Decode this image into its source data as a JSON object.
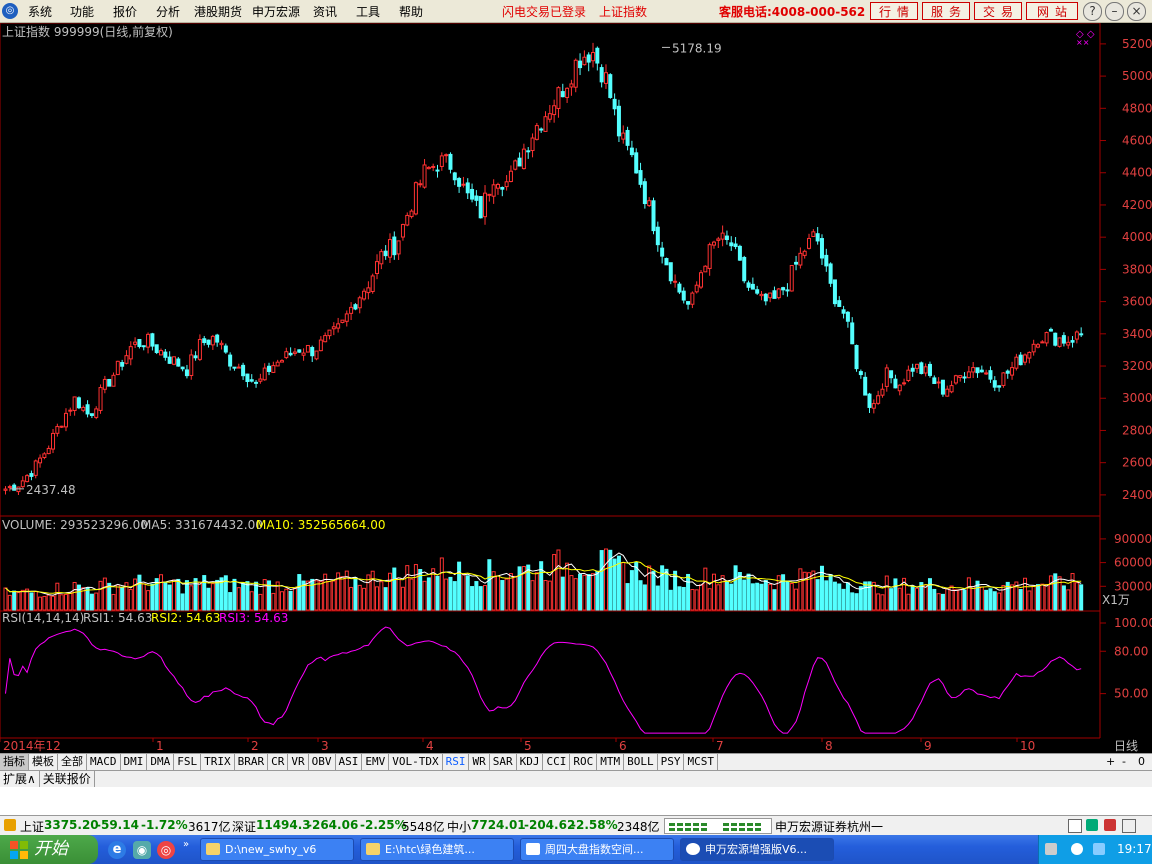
{
  "menu": {
    "items": [
      "系统",
      "功能",
      "报价",
      "分析",
      "港股期货",
      "申万宏源",
      "资讯",
      "工具",
      "帮助"
    ],
    "notice1": "闪电交易已登录",
    "notice2": "上证指数",
    "phone": "客服电话:4008-000-562",
    "buttons": [
      "行情",
      "服务",
      "交易",
      "网站"
    ]
  },
  "chart_header": {
    "title": "上证指数 999999(日线,前复权)",
    "high_label": "5178.19",
    "low_label": "2437.48",
    "volume_label": "VOLUME: 293523296.00",
    "ma5_label": "MA5: 331674432.00",
    "ma10_label": "MA10: 352565664.00",
    "rsi_label": "RSI(14,14,14)",
    "rsi1_label": "RSI1: 54.63",
    "rsi2_label": "RSI2: 54.63",
    "rsi3_label": "RSI3: 54.63",
    "vol_unit": "X1万",
    "period": "日线"
  },
  "chart_data": [
    {
      "type": "candlestick",
      "title": "上证指数 999999(日线,前复权)",
      "ylim": [
        2300,
        5280
      ],
      "yticks": [
        2400,
        2600,
        2800,
        3000,
        3200,
        3400,
        3600,
        3800,
        4000,
        4200,
        4400,
        4600,
        4800,
        5000,
        5200
      ],
      "x_labels": [
        "2014年12",
        "1",
        "2",
        "3",
        "4",
        "5",
        "6",
        "7",
        "8",
        "9",
        "10"
      ],
      "closes": [
        2437,
        2470,
        2560,
        2690,
        2860,
        3000,
        2890,
        3060,
        3180,
        3320,
        3360,
        3300,
        3234,
        3180,
        3340,
        3380,
        3240,
        3180,
        3075,
        3200,
        3250,
        3310,
        3300,
        3360,
        3440,
        3600,
        3720,
        3900,
        3960,
        4200,
        4400,
        4470,
        4450,
        4260,
        4150,
        4400,
        4330,
        4530,
        4690,
        4810,
        4940,
        5110,
        5160,
        4980,
        4620,
        4470,
        4200,
        3920,
        3700,
        3560,
        3850,
        3990,
        3950,
        3710,
        3600,
        3600,
        3720,
        3900,
        4020,
        3700,
        3530,
        3190,
        2930,
        3150,
        3090,
        3200,
        3150,
        3050,
        3100,
        3200,
        3170,
        3100,
        3180,
        3280,
        3390,
        3380,
        3360,
        3400
      ],
      "annotations": [
        {
          "text": "5178.19",
          "value": 5178.19
        },
        {
          "text": "2437.48",
          "value": 2437.48
        }
      ]
    },
    {
      "type": "bar",
      "title": "VOLUME",
      "ylim": [
        0,
        100000
      ],
      "yticks": [
        30000,
        60000,
        90000
      ],
      "unit": "X1万"
    },
    {
      "type": "line",
      "title": "RSI(14,14,14)",
      "ylim": [
        20,
        100
      ],
      "yticks": [
        50,
        80,
        100
      ],
      "series": [
        {
          "name": "RSI1"
        }
      ]
    }
  ],
  "axes_labels": {
    "price": [
      "2400",
      "2600",
      "2800",
      "3000",
      "3200",
      "3400",
      "3600",
      "3800",
      "4000",
      "4200",
      "4400",
      "4600",
      "4800",
      "5000",
      "5200"
    ],
    "volume": [
      "30000",
      "60000",
      "90000"
    ],
    "rsi": [
      "50.00",
      "80.00",
      "100.00"
    ]
  },
  "indicator_tabs": [
    "指标",
    "模板",
    "全部",
    "MACD",
    "DMI",
    "DMA",
    "FSL",
    "TRIX",
    "BRAR",
    "CR",
    "VR",
    "OBV",
    "ASI",
    "EMV",
    "VOL-TDX",
    "RSI",
    "WR",
    "SAR",
    "KDJ",
    "CCI",
    "ROC",
    "MTM",
    "BOLL",
    "PSY",
    "MCST"
  ],
  "ext_tabs": [
    "扩展∧",
    "关联报价"
  ],
  "tab_controls": [
    "+",
    "-",
    "0"
  ],
  "status": {
    "sh_name": "上证",
    "sh_val": "3375.20",
    "sh_chg": "-59.14",
    "sh_pct": "-1.72%",
    "sh_amt": "3617亿",
    "sz_name": "深证",
    "sz_val": "11494.3",
    "sz_chg": "-264.06",
    "sz_pct": "-2.25%",
    "sz_amt": "5548亿",
    "zx_name": "中小",
    "zx_val": "7724.01",
    "zx_chg": "-204.62",
    "zx_pct": "-2.58%",
    "zx_amt": "2348亿",
    "broker": "申万宏源证券杭州一"
  },
  "taskbar": {
    "start": "开始",
    "tasks": [
      "D:\\new_swhy_v6",
      "E:\\htc\\绿色建筑...",
      "周四大盘指数空间...",
      "申万宏源增强版V6..."
    ],
    "clock": "19:17"
  },
  "colors": {
    "up": "#ff3232",
    "down": "#54ffff",
    "ma5": "#ffffff",
    "ma10": "#ffff00",
    "rsi": "#ff00ff"
  }
}
